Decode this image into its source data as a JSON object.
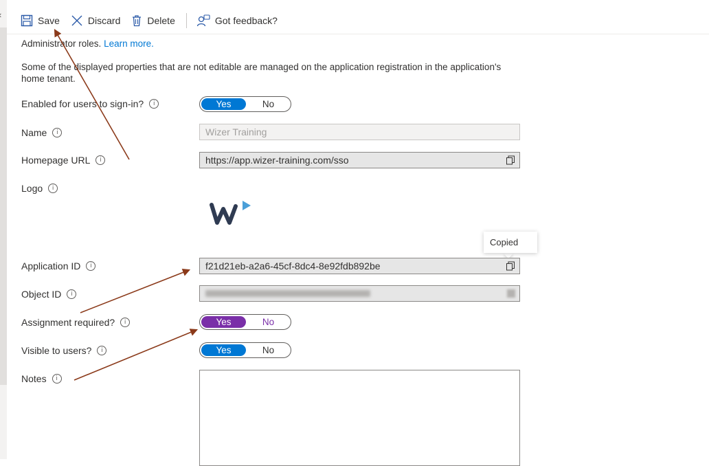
{
  "toolbar": {
    "save_label": "Save",
    "discard_label": "Discard",
    "delete_label": "Delete",
    "feedback_label": "Got feedback?"
  },
  "notice": {
    "line1_tail": "Administrator roles.",
    "learn_more": "Learn more.",
    "managed_line1": "Some of the displayed properties that are not editable are managed on the application registration in the application's",
    "managed_line2": "home tenant."
  },
  "fields": {
    "enabled_label": "Enabled for users to sign-in?",
    "name_label": "Name",
    "name_value": "Wizer Training",
    "homepage_label": "Homepage URL",
    "homepage_value": "https://app.wizer-training.com/sso",
    "logo_label": "Logo",
    "app_id_label": "Application ID",
    "app_id_value": "f21d21eb-a2a6-45cf-8dc4-8e92fdb892be",
    "object_id_label": "Object ID",
    "assignment_label": "Assignment required?",
    "visible_label": "Visible to users?",
    "notes_label": "Notes"
  },
  "toggles": {
    "yes": "Yes",
    "no": "No",
    "enabled": "Yes",
    "assignment": "Yes",
    "visible": "Yes"
  },
  "tooltip": {
    "text": "Copied"
  },
  "colors": {
    "accent": "#0078d4",
    "assignment_toggle": "#7a2fa8",
    "annotation_arrow": "#8b3a1a"
  }
}
